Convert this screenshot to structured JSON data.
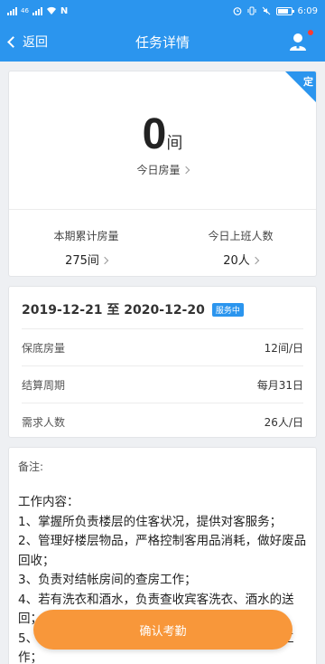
{
  "statusbar": {
    "carrier_left": "46",
    "nfc": "N",
    "time": "6:09"
  },
  "nav": {
    "back_label": "返回",
    "title": "任务详情"
  },
  "summary": {
    "corner_tag": "定",
    "today_rooms_value": "0",
    "today_rooms_unit": "间",
    "today_rooms_label": "今日房量",
    "period_total_label": "本期累计房量",
    "period_total_value": "275间",
    "today_workers_label": "今日上班人数",
    "today_workers_value": "20人"
  },
  "details": {
    "date_range": "2019-12-21 至 2020-12-20",
    "status_badge": "服务中",
    "rows": [
      {
        "label": "保底房量",
        "value": "12间/日"
      },
      {
        "label": "结算周期",
        "value": "每月31日"
      },
      {
        "label": "需求人数",
        "value": "26人/日"
      }
    ]
  },
  "notes": {
    "remark_label": "备注:",
    "content_lines": [
      "工作内容：",
      "1、掌握所负责楼层的住客状况，提供对客服务；",
      "2、管理好楼层物品，严格控制客用品消耗，做好废品回收；",
      "3、负责对结帐房间的查房工作；",
      "4、若有洗衣和酒水，负责查收宾客洗衣、酒水的送回；",
      "5、负责楼层公共区域及所负责区域的房间的清洁工作；"
    ]
  },
  "action": {
    "confirm_label": "确认考勤"
  },
  "colors": {
    "primary": "#2b95ee",
    "accent": "#f8973a"
  }
}
